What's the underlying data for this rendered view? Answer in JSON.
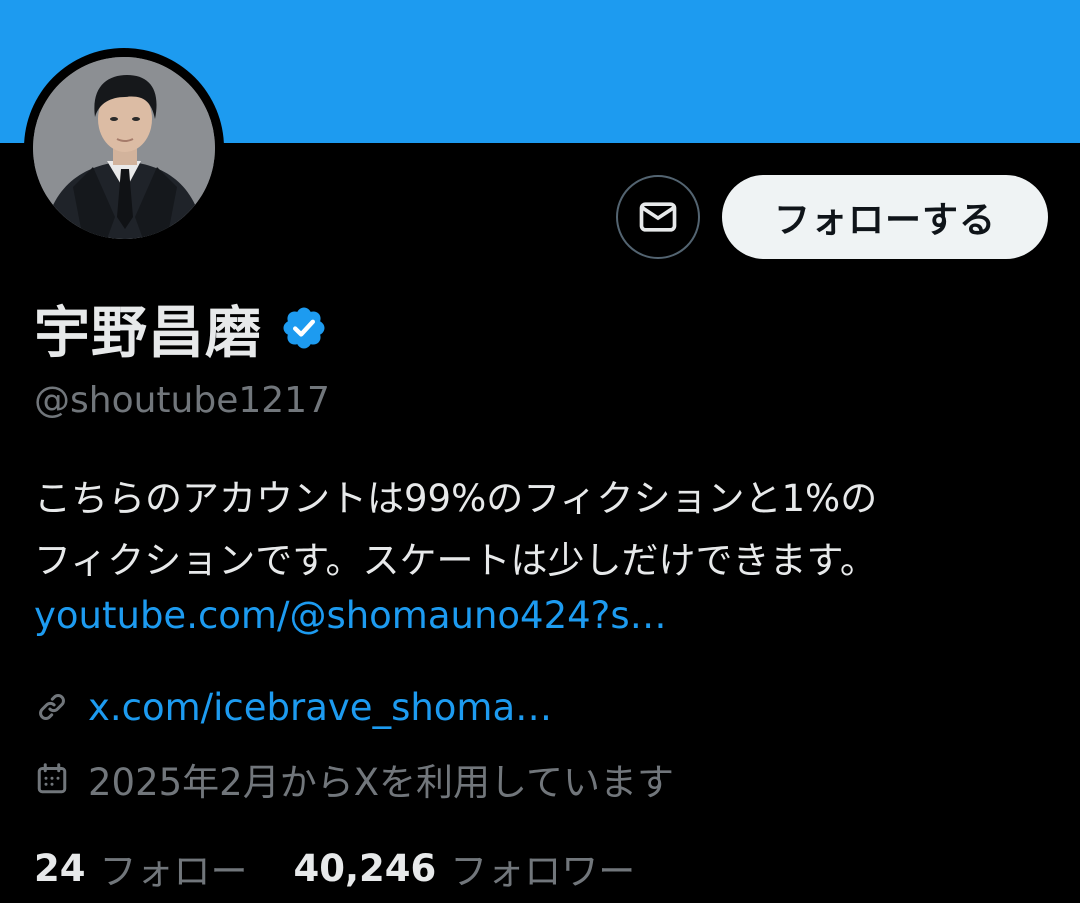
{
  "colors": {
    "banner": "#1d9bf0",
    "accent": "#1d9bf0",
    "background": "#000000",
    "text_primary": "#e7e9ea",
    "text_secondary": "#71767b"
  },
  "header": {
    "banner_icon": "banner-image",
    "avatar_icon": "profile-photo",
    "message_button_icon": "envelope-icon",
    "follow_label": "フォローする"
  },
  "profile": {
    "name": "宇野昌磨",
    "verified_icon": "verified-badge-icon",
    "handle": "@shoutube1217",
    "bio_lines": [
      "こちらのアカウントは99%のフィクションと1%の",
      "フィクションです。スケートは少しだけできます。"
    ],
    "bio_link": "youtube.com/@shomauno424?s…",
    "website_icon": "link-icon",
    "website": "x.com/icebrave_shoma…",
    "joined_icon": "calendar-icon",
    "joined": "2025年2月からXを利用しています"
  },
  "stats": {
    "following_count": "24",
    "following_label": "フォロー",
    "followers_count": "40,246",
    "followers_label": "フォロワー"
  }
}
